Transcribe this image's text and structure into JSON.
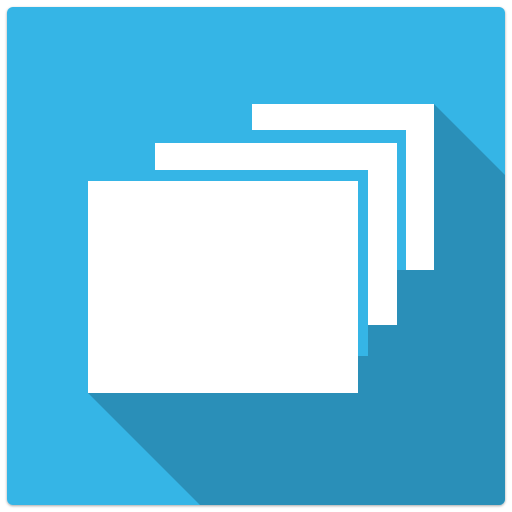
{
  "icon": {
    "name": "stacked-windows-icon",
    "colors": {
      "background": "#35B5E6",
      "long_shadow": "#2A8FB8",
      "windows": "#FFFFFF"
    }
  }
}
